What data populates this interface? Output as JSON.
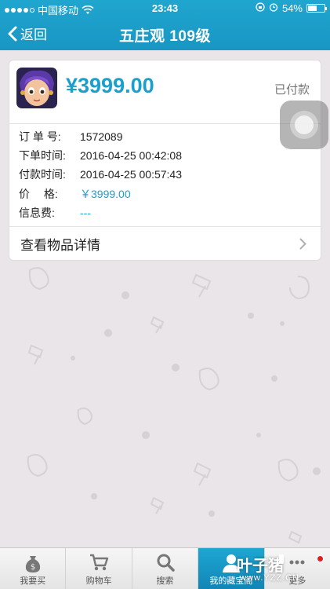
{
  "status_bar": {
    "carrier": "中国移动",
    "time": "23:43",
    "battery": "54%"
  },
  "nav": {
    "back_label": "返回",
    "title": "五庄观 109级"
  },
  "order": {
    "price": "¥3999.00",
    "status": "已付款",
    "rows": [
      {
        "label": "订 单 号:",
        "value": "1572089"
      },
      {
        "label": "下单时间:",
        "value": "2016-04-25 00:42:08"
      },
      {
        "label": "付款时间:",
        "value": "2016-04-25 00:57:43"
      },
      {
        "label": "价　 格:",
        "value": "￥3999.00"
      },
      {
        "label": "信息费:",
        "value": "---"
      }
    ],
    "details_label": "查看物品详情"
  },
  "tabbar": {
    "items": [
      {
        "label": "我要买",
        "icon": "money-bag-icon"
      },
      {
        "label": "购物车",
        "icon": "cart-icon"
      },
      {
        "label": "搜索",
        "icon": "search-icon"
      },
      {
        "label": "我的藏宝阁",
        "icon": "user-icon"
      },
      {
        "label": "更多",
        "icon": "more-icon"
      }
    ]
  },
  "watermark": {
    "text": "叶子猪",
    "url": "www.YZZ.CN"
  },
  "colors": {
    "accent": "#1aa0cc",
    "header": "#1fa6cf",
    "background": "#e9e5e8"
  }
}
